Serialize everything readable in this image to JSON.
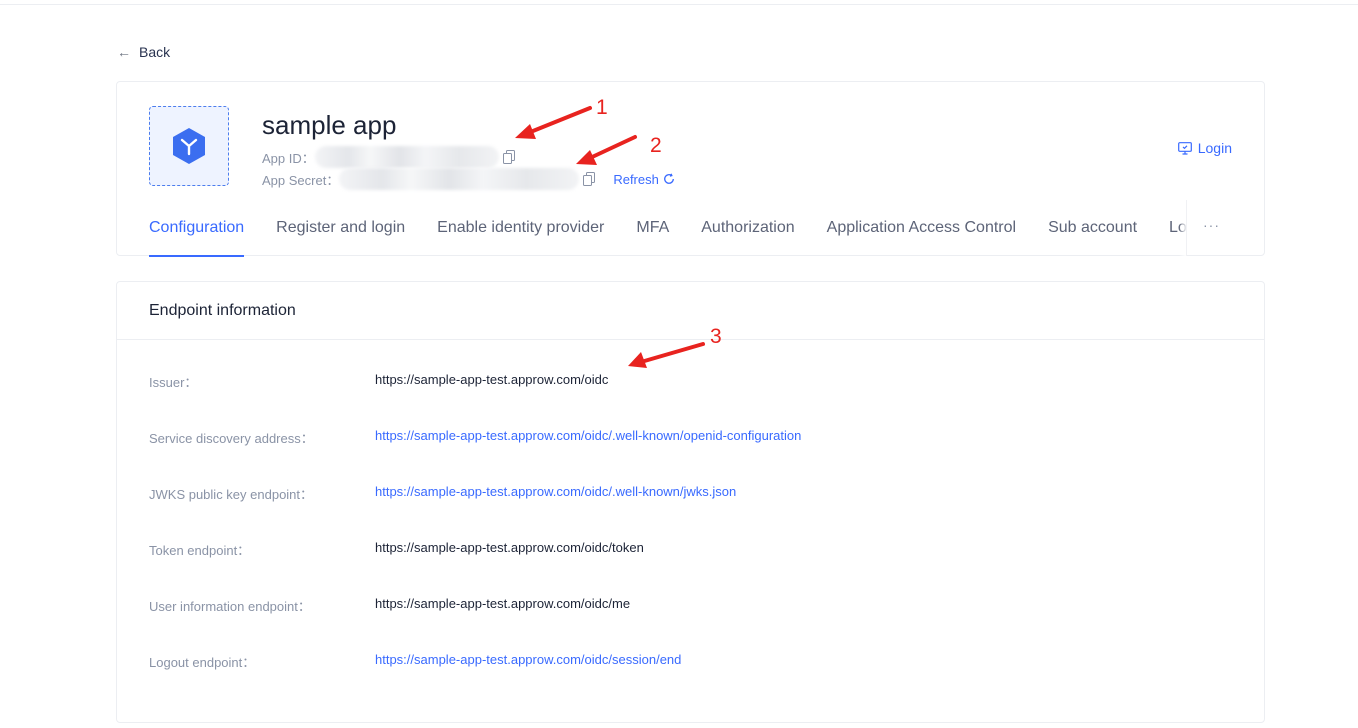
{
  "back_label": "Back",
  "app": {
    "name": "sample app",
    "app_id_label": "App ID：",
    "app_secret_label": "App Secret：",
    "refresh_label": "Refresh",
    "login_label": "Login"
  },
  "tabs": [
    {
      "label": "Configuration",
      "active": true
    },
    {
      "label": "Register and login"
    },
    {
      "label": "Enable identity provider"
    },
    {
      "label": "MFA"
    },
    {
      "label": "Authorization"
    },
    {
      "label": "Application Access Control"
    },
    {
      "label": "Sub account"
    },
    {
      "label": "Lo"
    }
  ],
  "more_label": "···",
  "endpoint": {
    "title": "Endpoint information",
    "rows": [
      {
        "label": "Issuer：",
        "value": "https://sample-app-test.approw.com/oidc",
        "link": false
      },
      {
        "label": "Service discovery address：",
        "value": "https://sample-app-test.approw.com/oidc/.well-known/openid-configuration",
        "link": true
      },
      {
        "label": "JWKS public key endpoint：",
        "value": "https://sample-app-test.approw.com/oidc/.well-known/jwks.json",
        "link": true
      },
      {
        "label": "Token endpoint：",
        "value": "https://sample-app-test.approw.com/oidc/token",
        "link": false
      },
      {
        "label": "User information endpoint：",
        "value": "https://sample-app-test.approw.com/oidc/me",
        "link": false
      },
      {
        "label": "Logout endpoint：",
        "value": "https://sample-app-test.approw.com/oidc/session/end",
        "link": true
      }
    ]
  },
  "annotations": [
    "1",
    "2",
    "3"
  ],
  "colors": {
    "accent": "#396aff",
    "annotation": "#e8231f",
    "label": "#8a93a6"
  }
}
